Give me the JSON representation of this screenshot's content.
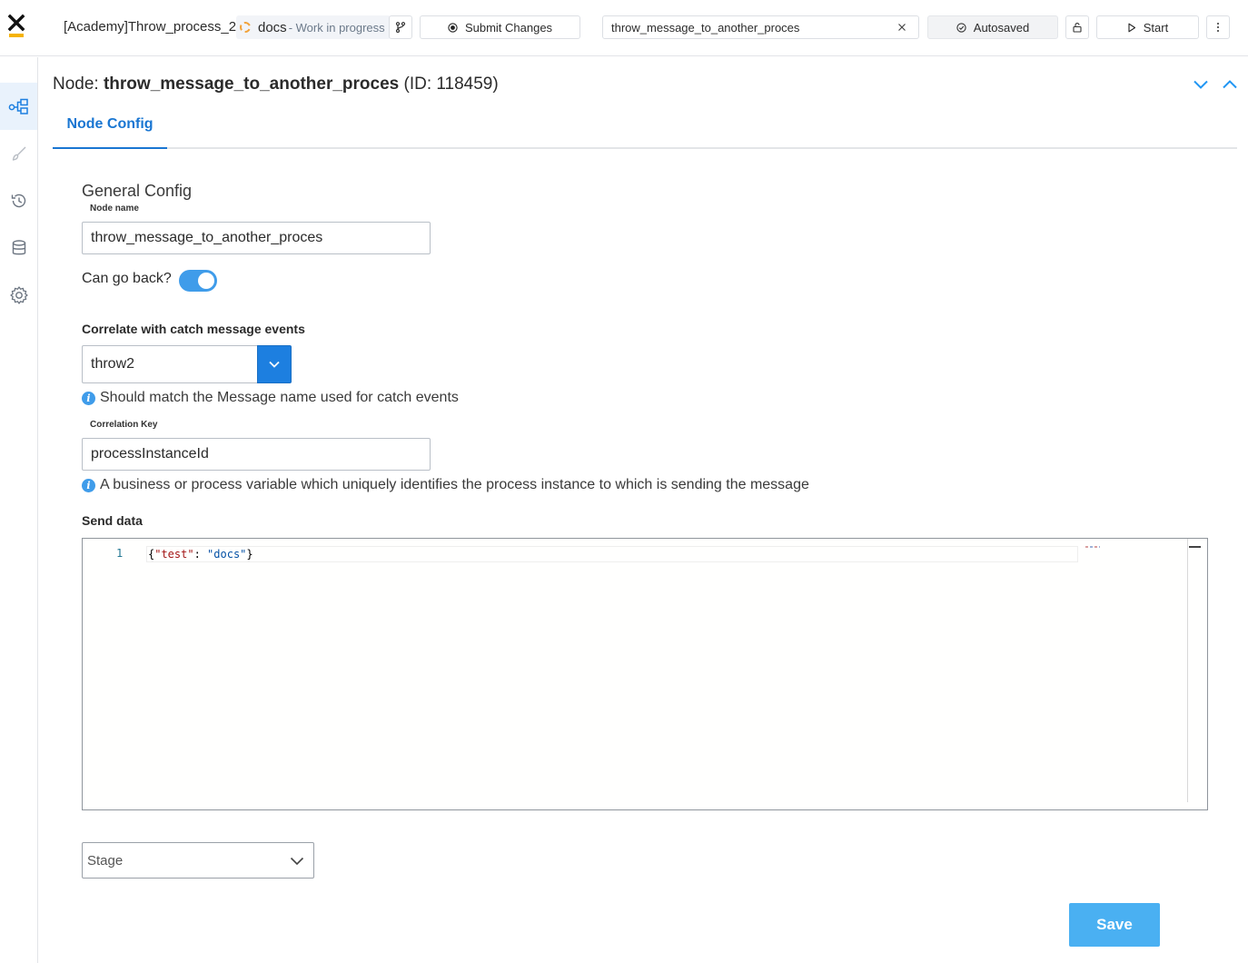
{
  "header": {
    "process_title": "[Academy]Throw_process_2",
    "branch_name": "docs",
    "branch_status": "- Work in progress",
    "submit_label": "Submit Changes",
    "search_value": "throw_message_to_another_proces",
    "autosave_label": "Autosaved",
    "start_label": "Start"
  },
  "sidebar": {
    "items": [
      {
        "icon": "process-nodes-icon",
        "active": true
      },
      {
        "icon": "brush-icon",
        "active": false
      },
      {
        "icon": "history-icon",
        "active": false
      },
      {
        "icon": "database-icon",
        "active": false
      },
      {
        "icon": "gear-icon",
        "active": false
      }
    ]
  },
  "node": {
    "prefix": "Node: ",
    "name": "throw_message_to_another_proces",
    "id_text": "(ID: 118459)",
    "tab_label": "Node Config"
  },
  "form": {
    "section_title": "General Config",
    "node_name_label": "Node name",
    "node_name_value": "throw_message_to_another_proces",
    "can_go_back_label": "Can go back?",
    "can_go_back_on": true,
    "correlate_label": "Correlate with catch message events",
    "correlate_value": "throw2",
    "correlate_hint": "Should match the Message name used for catch events",
    "correlation_key_label": "Correlation Key",
    "correlation_key_value": "processInstanceId",
    "correlation_key_hint": "A business or process variable which uniquely identifies the process instance to which is sending the message",
    "send_data_label": "Send data",
    "send_data_line_number": "1",
    "send_data_tokens": {
      "open": "{",
      "key": "\"test\"",
      "colon": ": ",
      "value": "\"docs\"",
      "close": "}"
    },
    "stage_placeholder": "Stage",
    "save_label": "Save"
  },
  "colors": {
    "accent": "#1976d2",
    "toggle_on": "#3f9cea",
    "save_button": "#4ab0f2",
    "logo_underline": "#f5b300"
  }
}
